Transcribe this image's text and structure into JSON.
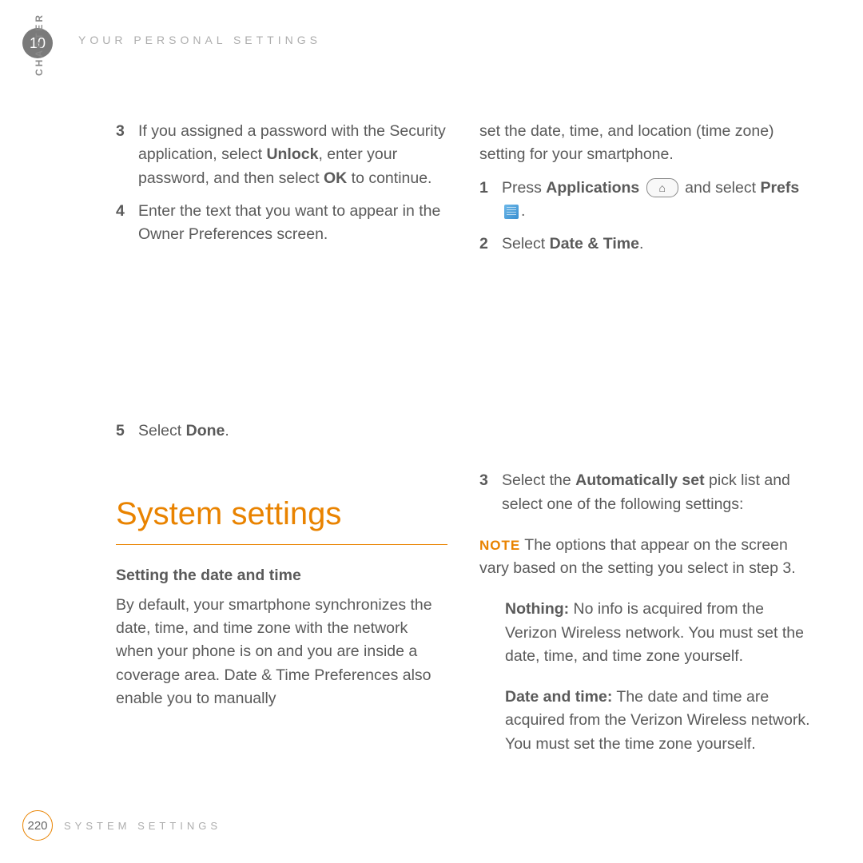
{
  "chapter": {
    "number": "10",
    "label": "CHAPTER",
    "title": "YOUR PERSONAL SETTINGS"
  },
  "left": {
    "step3": {
      "num": "3",
      "t1": "If you assigned a password with the Security application, select ",
      "b1": "Unlock",
      "t2": ", enter your password, and then select ",
      "b2": "OK",
      "t3": " to continue."
    },
    "step4": {
      "num": "4",
      "text": "Enter the text that you want to appear in the Owner Preferences screen."
    },
    "step5": {
      "num": "5",
      "t1": "Select ",
      "b1": "Done",
      "t2": "."
    },
    "heading": "System settings",
    "sub": "Setting the date and time",
    "intro": "By default, your smartphone synchronizes the date, time, and time zone with the network when your phone is on and you are inside a coverage area. Date & Time Preferences also enable you to manually"
  },
  "right": {
    "cont": "set the date, time, and location (time zone) setting for your smartphone.",
    "s1": {
      "num": "1",
      "t1": "Press ",
      "b1": "Applications",
      "t2": " and select ",
      "b2": "Prefs",
      "t3": "."
    },
    "s2": {
      "num": "2",
      "t1": "Select ",
      "b1": "Date & Time",
      "t2": "."
    },
    "s3": {
      "num": "3",
      "t1": "Select the ",
      "b1": "Automatically set",
      "t2": " pick list and select one of the following settings:"
    },
    "note": {
      "label": "NOTE",
      "text": " The options that appear on the screen vary based on the setting you select in step 3."
    },
    "d1": {
      "term": "Nothing:",
      "text": " No info is acquired from the Verizon Wireless network. You must set the date, time, and time zone yourself."
    },
    "d2": {
      "term": "Date and time:",
      "text": " The date and time are acquired from the Verizon Wireless network. You must set the time zone yourself."
    }
  },
  "footer": {
    "page": "220",
    "title": "SYSTEM SETTINGS"
  },
  "icons": {
    "home": "⌂"
  }
}
